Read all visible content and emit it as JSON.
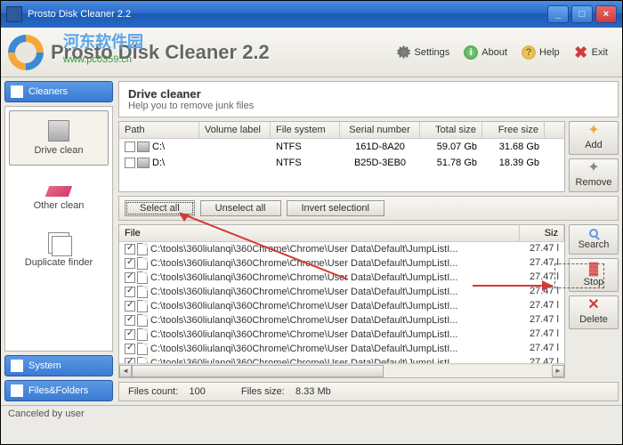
{
  "window": {
    "title": "Prosto Disk Cleaner 2.2",
    "brand": "Prosto Disk Cleaner 2.2",
    "watermark": "www.pc0359.cn",
    "watermark_cn": "河东软件园"
  },
  "titlebar_buttons": {
    "minimize": "_",
    "maximize": "□",
    "close": "×"
  },
  "header": {
    "settings": "Settings",
    "about": "About",
    "help": "Help",
    "exit": "Exit"
  },
  "sidebar": {
    "cleaners": "Cleaners",
    "system": "System",
    "files_folders": "Files&Folders",
    "items": [
      {
        "label": "Drive clean"
      },
      {
        "label": "Other clean"
      },
      {
        "label": "Duplicate finder"
      }
    ]
  },
  "panel": {
    "title": "Drive cleaner",
    "subtitle": "Help you to remove junk files"
  },
  "drive_table": {
    "cols": {
      "path": "Path",
      "volume": "Volume label",
      "fs": "File system",
      "serial": "Serial number",
      "total": "Total size",
      "free": "Free size"
    },
    "rows": [
      {
        "path": "C:\\",
        "volume": "",
        "fs": "NTFS",
        "serial": "161D-8A20",
        "total": "59.07 Gb",
        "free": "31.68 Gb"
      },
      {
        "path": "D:\\",
        "volume": "",
        "fs": "NTFS",
        "serial": "B25D-3EB0",
        "total": "51.78 Gb",
        "free": "18.39 Gb"
      }
    ]
  },
  "buttons": {
    "add": "Add",
    "remove": "Remove",
    "search": "Search",
    "stop": "Stop",
    "delete": "Delete",
    "select_all": "Select all",
    "unselect_all": "Unselect all",
    "invert": "Invert selectionl"
  },
  "file_table": {
    "cols": {
      "file": "File",
      "size": "Siz"
    },
    "path_prefix": "C:\\tools\\360liulanqi\\360Chrome\\Chrome\\User Data\\Default\\JumpListI...",
    "size": "27.47 l",
    "count": 9
  },
  "status": {
    "files_count_label": "Files count:",
    "files_count": "100",
    "files_size_label": "Files size:",
    "files_size": "8.33 Mb"
  },
  "footer": {
    "text": "Canceled by user"
  }
}
